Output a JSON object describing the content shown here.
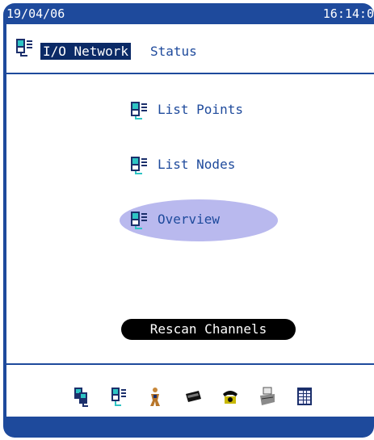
{
  "status_bar": {
    "date": "19/04/06",
    "time": "16:14:0"
  },
  "header": {
    "title_highlighted": "I/O Network",
    "title_rest": "Status"
  },
  "menu": {
    "items": [
      {
        "label": "List Points"
      },
      {
        "label": "List Nodes"
      },
      {
        "label": "Overview",
        "highlighted": true
      }
    ]
  },
  "actions": {
    "rescan_label": "Rescan Channels"
  },
  "toolbar": {
    "icons": [
      "network-nodes-icon",
      "io-module-icon",
      "user-figure-icon",
      "keyboard-icon",
      "telephone-icon",
      "printer-icon",
      "calendar-icon"
    ]
  },
  "colors": {
    "frame": "#1e4a9c",
    "text": "#1e4a9c",
    "highlight": "#b9b9ee",
    "title_bg": "#0b2a66"
  }
}
